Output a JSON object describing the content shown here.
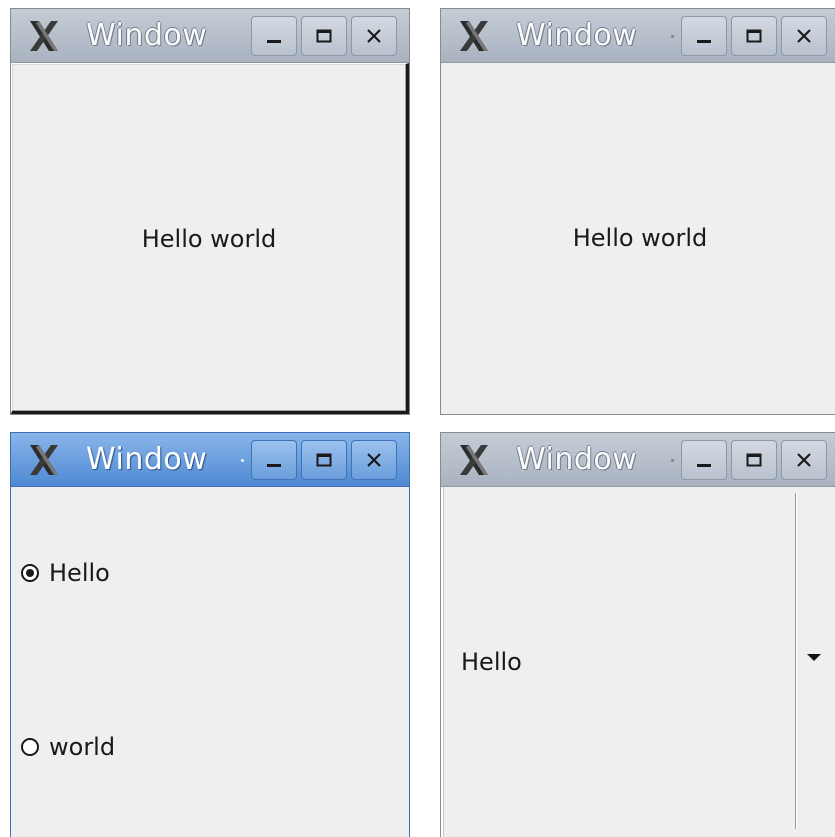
{
  "windows": [
    {
      "title": "Window",
      "titlebar_state": "inactive",
      "content_type": "label",
      "label": "Hello world"
    },
    {
      "title": "Window",
      "titlebar_state": "inactive",
      "content_type": "label",
      "label": "Hello world"
    },
    {
      "title": "Window",
      "titlebar_state": "active",
      "content_type": "radio-group",
      "radios": [
        {
          "label": "Hello",
          "checked": true
        },
        {
          "label": "world",
          "checked": false
        }
      ]
    },
    {
      "title": "Window",
      "titlebar_state": "inactive",
      "content_type": "combobox",
      "selected": "Hello"
    }
  ],
  "icons": {
    "app": "x-logo-icon",
    "minimize": "minimize-icon",
    "maximize": "maximize-icon",
    "close": "close-icon",
    "dropdown": "dropdown-arrow-icon"
  },
  "colors": {
    "titlebar_inactive": "#b5bdc9",
    "titlebar_active": "#5f95d8",
    "window_bg": "#efefef"
  }
}
